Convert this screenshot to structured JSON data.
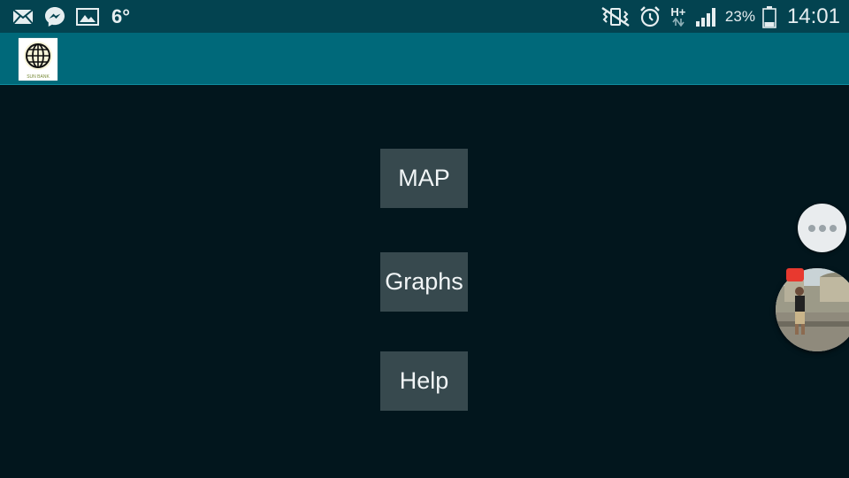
{
  "status_bar": {
    "temperature": "6°",
    "network_type": "H+",
    "battery_percent": "23%",
    "time": "14:01",
    "icons_left": [
      "mail-icon",
      "messenger-icon",
      "gallery-icon"
    ],
    "icons_right": [
      "vibrate-icon",
      "alarm-icon",
      "data-arrows-icon",
      "signal-icon",
      "battery-icon"
    ]
  },
  "action_bar": {
    "logo_text": "SUN BANK",
    "logo_icon": "globe-icon",
    "background": "#00697a"
  },
  "menu": {
    "buttons": [
      {
        "label": "MAP"
      },
      {
        "label": "Graphs"
      },
      {
        "label": "Help"
      }
    ],
    "button_color": "#37494e"
  },
  "chat_heads": {
    "more_icon": "more-dots-icon",
    "badge_color": "#e8392f"
  },
  "colors": {
    "status_bar": "#034350",
    "background": "#02161d"
  }
}
